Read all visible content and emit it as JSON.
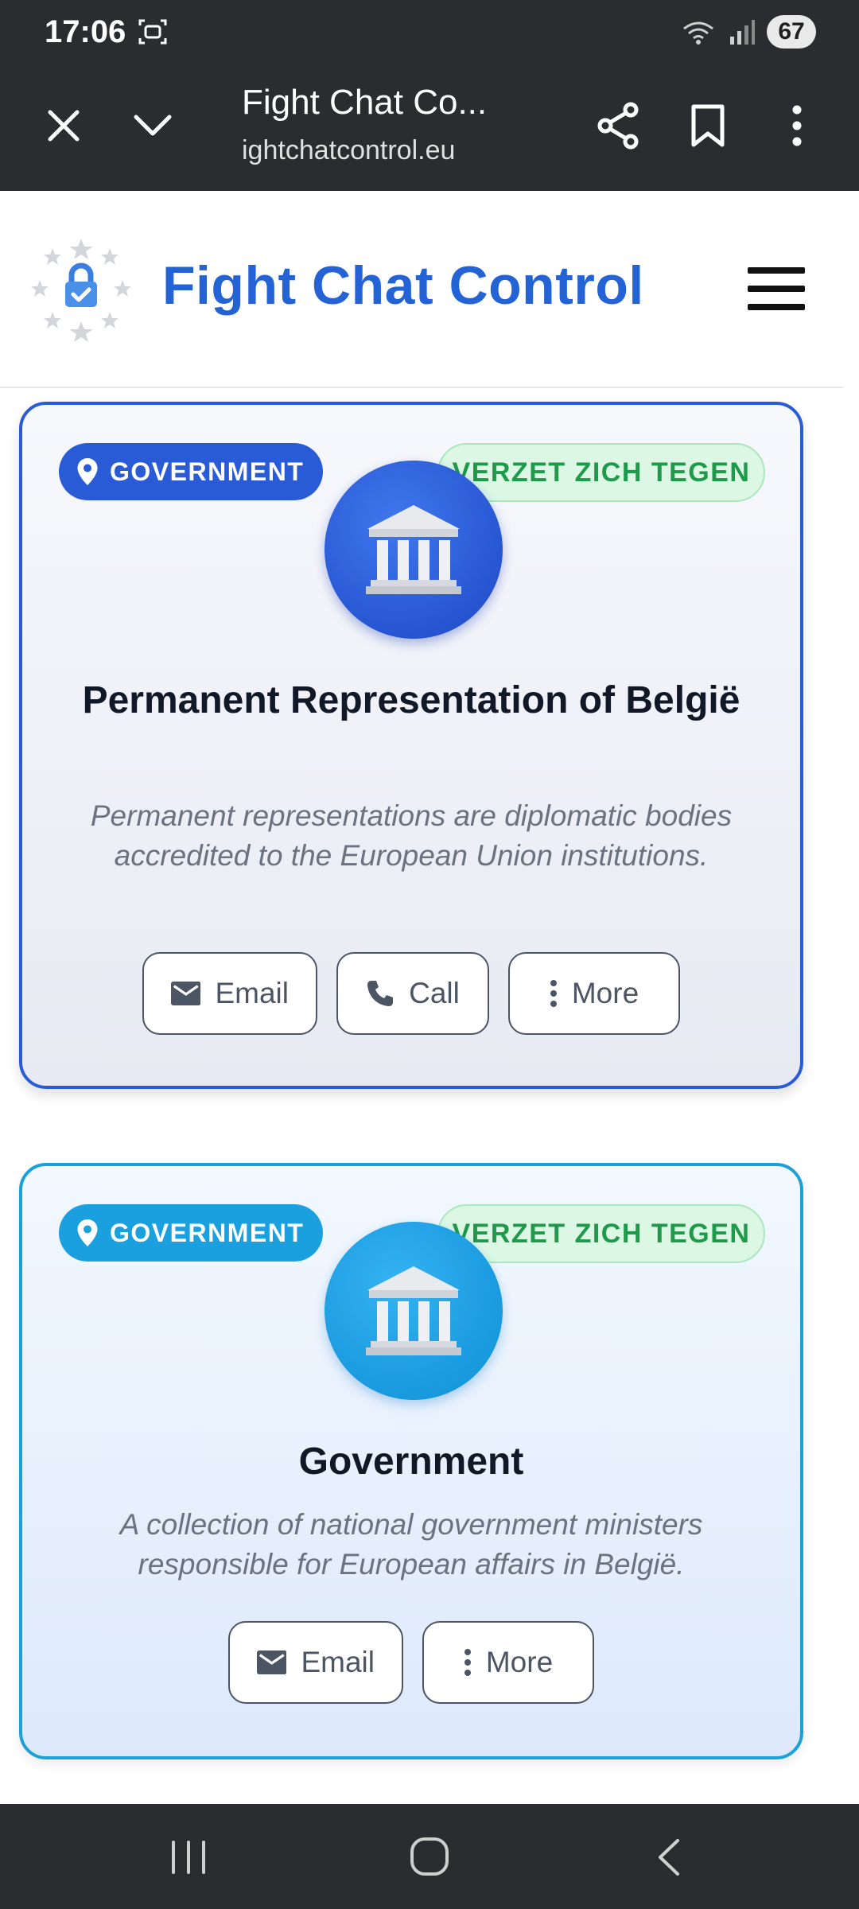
{
  "status_bar": {
    "time": "17:06",
    "battery": "67"
  },
  "browser": {
    "tab_title": "Fight Chat Co...",
    "url": "ightchatcontrol.eu"
  },
  "header": {
    "site_title": "Fight Chat Control"
  },
  "cards": [
    {
      "category": "GOVERNMENT",
      "stance": "VERZET ZICH TEGEN",
      "title": "Permanent Representation of België",
      "description": "Permanent representations are diplomatic bodies accredited to the European Union institutions.",
      "actions": {
        "email": "Email",
        "call": "Call",
        "more": "More"
      },
      "accent": "#2a5bd6"
    },
    {
      "category": "GOVERNMENT",
      "stance": "VERZET ZICH TEGEN",
      "title": "Government",
      "description": "A collection of national government ministers responsible for European affairs in België.",
      "actions": {
        "email": "Email",
        "more": "More"
      },
      "accent": "#1ca0d8"
    }
  ],
  "colors": {
    "brand": "#2463d6",
    "oppose_text": "#1e9a4a",
    "oppose_bg": "#dcf7e4"
  }
}
